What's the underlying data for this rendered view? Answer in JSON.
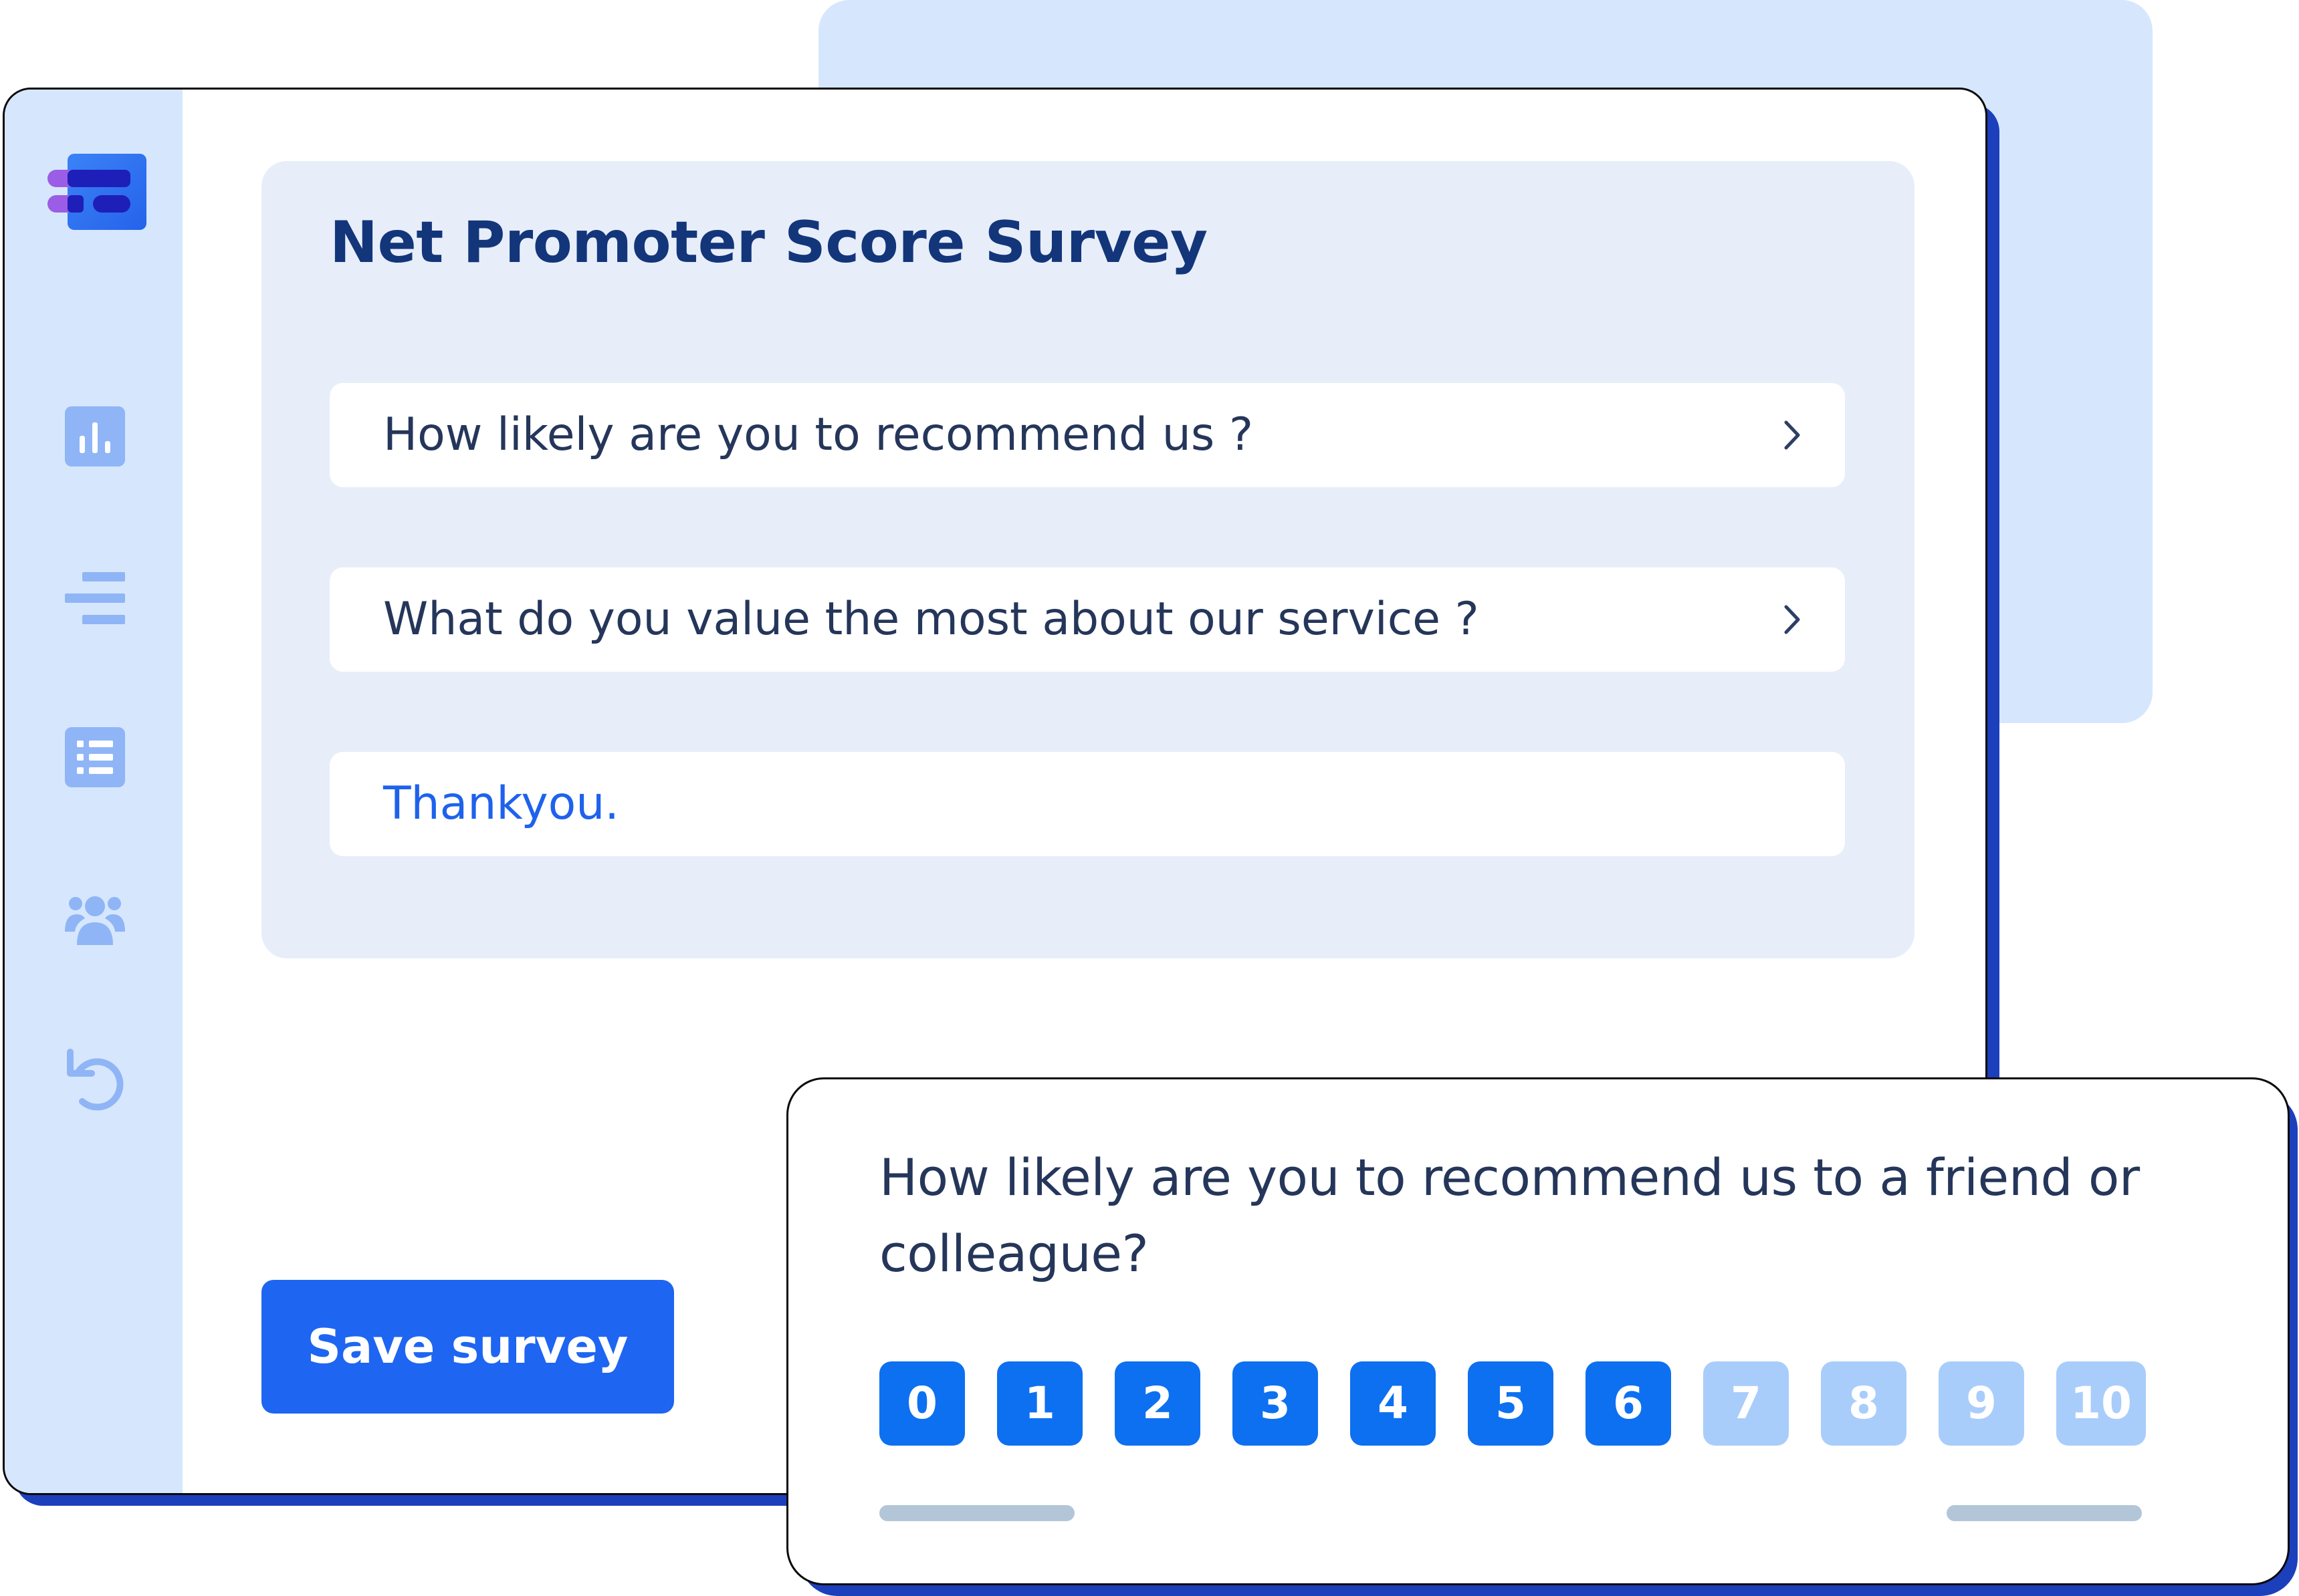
{
  "survey": {
    "title": "Net Promoter Score Survey",
    "questions": [
      {
        "text": "How likely are you to recommend us ?"
      },
      {
        "text": "What do you value the most about our service ?"
      }
    ],
    "thank_you": "Thankyou."
  },
  "actions": {
    "save_label": "Save survey"
  },
  "sidebar": {
    "icons": [
      "bar-chart-icon",
      "align-lines-icon",
      "list-icon",
      "users-icon",
      "undo-icon"
    ]
  },
  "nps_popup": {
    "question": "How likely are you to recommend us to a friend or colleague?",
    "scores": [
      "0",
      "1",
      "2",
      "3",
      "4",
      "5",
      "6",
      "7",
      "8",
      "9",
      "10"
    ],
    "selected_up_to": 6
  },
  "colors": {
    "accent": "#1e65f1",
    "score_active": "#0d70f0",
    "score_inactive": "#a9cdfb",
    "title": "#13357a",
    "sidebar_bg": "#d6e7fd",
    "card_bg": "#e7eef9"
  }
}
